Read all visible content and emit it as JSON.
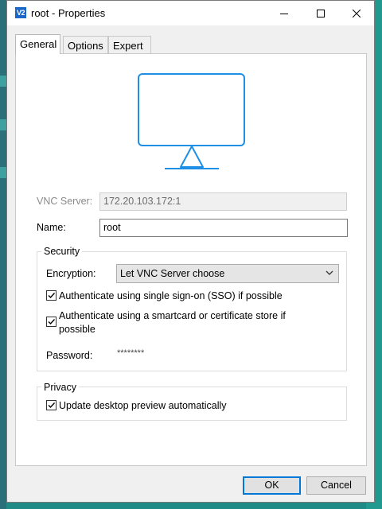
{
  "window": {
    "app_icon_text": "V2",
    "title": "root - Properties"
  },
  "tabs": [
    {
      "label": "General",
      "active": true
    },
    {
      "label": "Options",
      "active": false
    },
    {
      "label": "Expert",
      "active": false
    }
  ],
  "general": {
    "preview_icon": "monitor-icon",
    "vnc_server_label": "VNC Server:",
    "vnc_server_value": "172.20.103.172:1",
    "name_label": "Name:",
    "name_value": "root"
  },
  "security": {
    "title": "Security",
    "encryption_label": "Encryption:",
    "encryption_selected": "Let VNC Server choose",
    "sso_label": "Authenticate using single sign-on (SSO) if possible",
    "sso_checked": true,
    "smartcard_label": "Authenticate using a smartcard or certificate store if possible",
    "smartcard_checked": true,
    "password_label": "Password:",
    "password_value": "********"
  },
  "privacy": {
    "title": "Privacy",
    "update_preview_label": "Update desktop preview automatically",
    "update_preview_checked": true
  },
  "footer": {
    "ok_label": "OK",
    "cancel_label": "Cancel"
  },
  "colors": {
    "accent": "#0078d7",
    "monitor_stroke": "#1f8fe6",
    "app_icon_bg": "#1a66c9"
  }
}
